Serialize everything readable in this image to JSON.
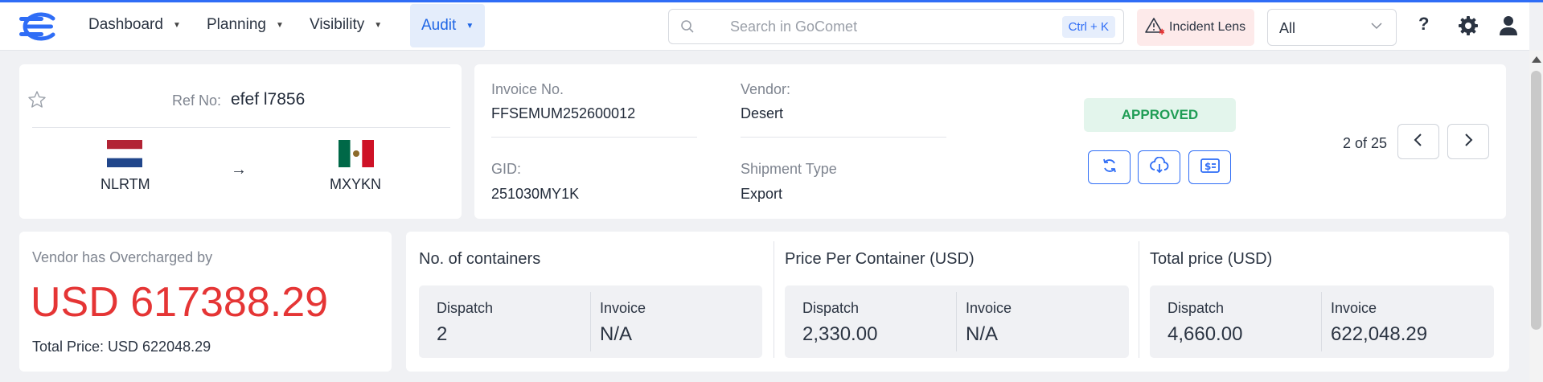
{
  "nav": {
    "menus": [
      {
        "label": "Dashboard"
      },
      {
        "label": "Planning"
      },
      {
        "label": "Visibility"
      },
      {
        "label": "Audit"
      }
    ],
    "search": {
      "placeholder": "Search in GoComet",
      "shortcut": "Ctrl + K"
    },
    "incident_label": "Incident Lens",
    "filter_value": "All",
    "help_label": "?"
  },
  "shipment": {
    "ref_label": "Ref No:",
    "ref_value": "efef l7856",
    "origin_code": "NLRTM",
    "destination_code": "MXYKN",
    "arrow": "→"
  },
  "invoice": {
    "invoice_no_label": "Invoice No.",
    "invoice_no_value": "FFSEMUM252600012",
    "vendor_label": "Vendor:",
    "vendor_value": "Desert",
    "gid_label": "GID:",
    "gid_value": "251030MY1K",
    "shipment_type_label": "Shipment Type",
    "shipment_type_value": "Export",
    "status": "APPROVED",
    "pager": "2 of 25"
  },
  "overcharge": {
    "label": "Vendor has Overcharged by",
    "amount": "USD 617388.29",
    "total": "Total Price: USD 622048.29"
  },
  "metrics": [
    {
      "title": "No. of containers",
      "dispatch_label": "Dispatch",
      "dispatch_value": "2",
      "invoice_label": "Invoice",
      "invoice_value": "N/A"
    },
    {
      "title": "Price Per Container (USD)",
      "dispatch_label": "Dispatch",
      "dispatch_value": "2,330.00",
      "invoice_label": "Invoice",
      "invoice_value": "N/A"
    },
    {
      "title": "Total price (USD)",
      "dispatch_label": "Dispatch",
      "dispatch_value": "4,660.00",
      "invoice_label": "Invoice",
      "invoice_value": "622,048.29"
    }
  ],
  "colors": {
    "accent": "#2f6df6",
    "approved_bg": "#e3f5ec",
    "approved_text": "#1f9d55",
    "overcharge": "#e53535"
  }
}
